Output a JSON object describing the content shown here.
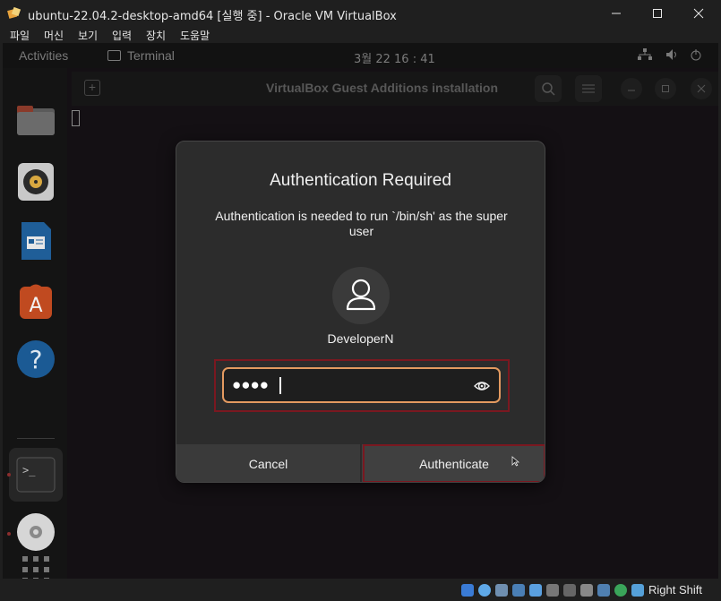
{
  "window": {
    "title": "ubuntu-22.04.2-desktop-amd64 [실행 중] - Oracle VM VirtualBox",
    "minimize_icon": "minimize-icon",
    "maximize_icon": "maximize-icon",
    "close_icon": "close-icon"
  },
  "menubar": {
    "items": [
      "파일",
      "머신",
      "보기",
      "입력",
      "장치",
      "도움말"
    ]
  },
  "ubuntu_topbar": {
    "activities": "Activities",
    "app_name": "Terminal",
    "clock": "3월 22  16 : 41"
  },
  "dock": {
    "items": [
      "files-icon",
      "rhythmbox-icon",
      "writer-icon",
      "software-icon",
      "help-icon",
      "terminal-icon",
      "dvd-icon",
      "app-grid-icon"
    ]
  },
  "terminal": {
    "title": "VirtualBox Guest Additions installation"
  },
  "dialog": {
    "title": "Authentication Required",
    "message": "Authentication is needed to run `/bin/sh' as the super user",
    "username": "DeveloperN",
    "password_mask": "●●●●",
    "cancel_label": "Cancel",
    "authenticate_label": "Authenticate"
  },
  "statusbar": {
    "host_key": "Right Shift"
  },
  "colors": {
    "accent_orange": "#e39a60",
    "highlight_red": "#7a1820",
    "dialog_bg": "#2c2c2c"
  }
}
